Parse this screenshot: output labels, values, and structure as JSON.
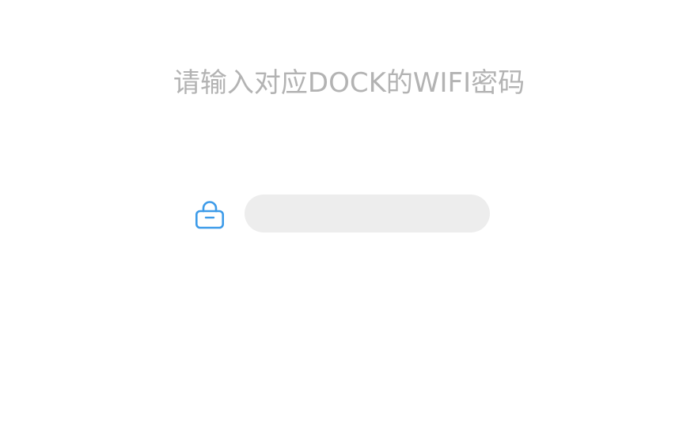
{
  "title": "请输入对应DOCK的WIFI密码",
  "password": {
    "value": "",
    "placeholder": "",
    "icon": "lock-icon"
  },
  "colors": {
    "title_text": "#b3b3b3",
    "accent": "#3d9be9",
    "field_background": "#ededed",
    "page_background": "#ffffff"
  }
}
